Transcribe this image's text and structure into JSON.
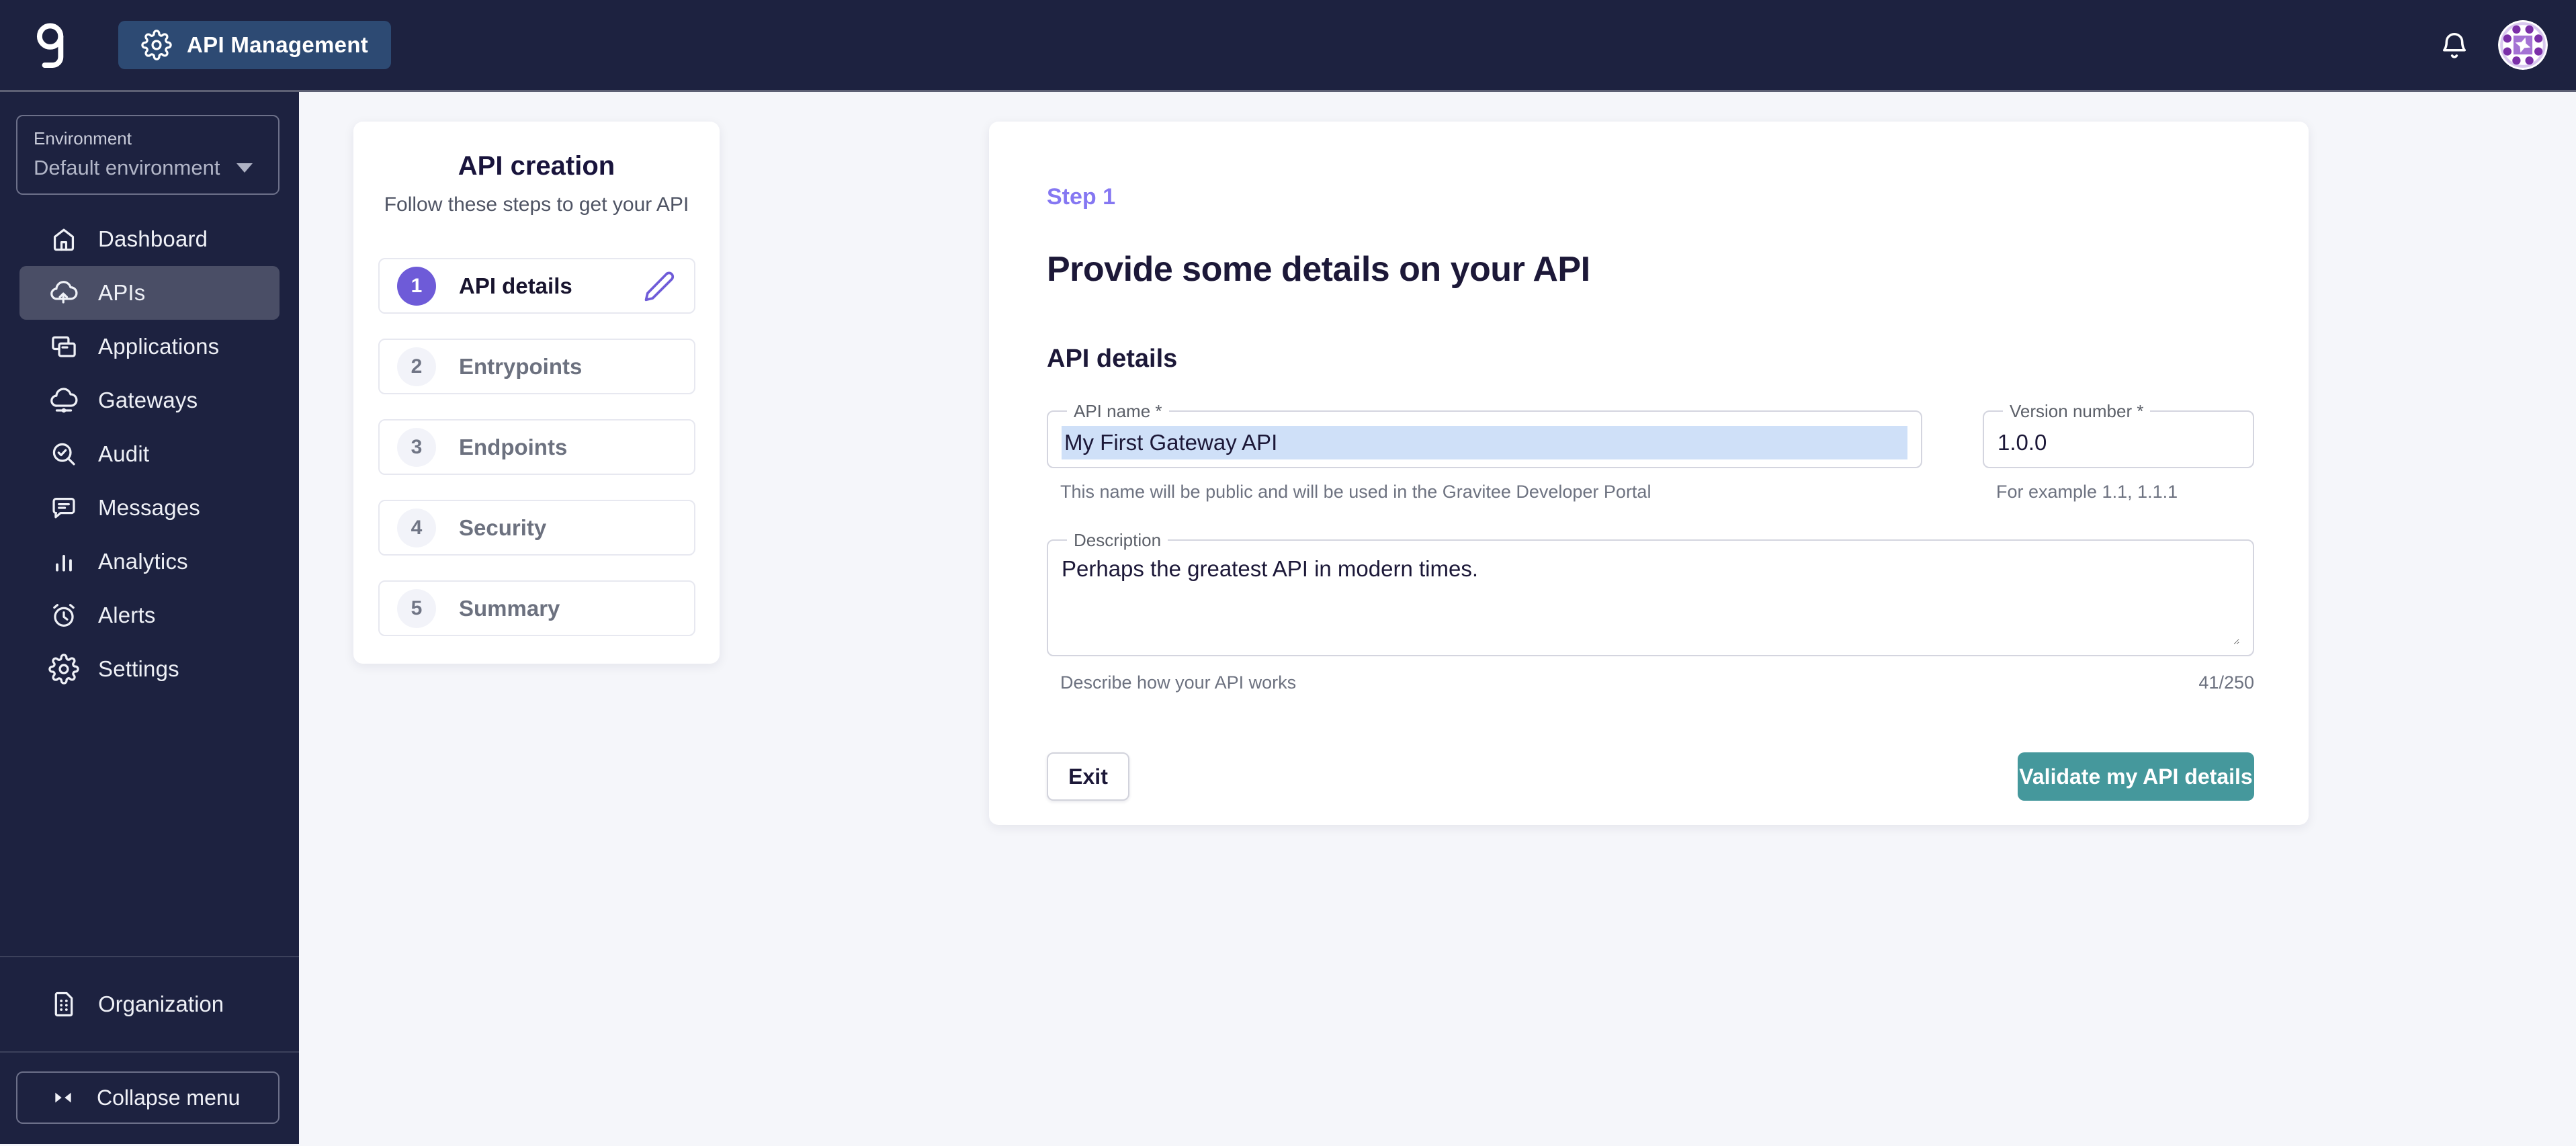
{
  "topbar": {
    "app_label": "API Management"
  },
  "sidebar": {
    "environment": {
      "label": "Environment",
      "value": "Default environment"
    },
    "items": [
      {
        "label": "Dashboard",
        "icon": "home-icon",
        "selected": false
      },
      {
        "label": "APIs",
        "icon": "cloud-upload-icon",
        "selected": true
      },
      {
        "label": "Applications",
        "icon": "applications-icon",
        "selected": false
      },
      {
        "label": "Gateways",
        "icon": "cloud-gateway-icon",
        "selected": false
      },
      {
        "label": "Audit",
        "icon": "magnifier-check-icon",
        "selected": false
      },
      {
        "label": "Messages",
        "icon": "chat-bubble-icon",
        "selected": false
      },
      {
        "label": "Analytics",
        "icon": "bar-chart-icon",
        "selected": false
      },
      {
        "label": "Alerts",
        "icon": "alarm-clock-icon",
        "selected": false
      },
      {
        "label": "Settings",
        "icon": "gear-icon",
        "selected": false
      }
    ],
    "organization_label": "Organization",
    "collapse_label": "Collapse menu"
  },
  "stepper": {
    "title": "API creation",
    "subtitle": "Follow these steps to get your API",
    "steps": [
      {
        "number": "1",
        "label": "API details",
        "active": true
      },
      {
        "number": "2",
        "label": "Entrypoints",
        "active": false
      },
      {
        "number": "3",
        "label": "Endpoints",
        "active": false
      },
      {
        "number": "4",
        "label": "Security",
        "active": false
      },
      {
        "number": "5",
        "label": "Summary",
        "active": false
      }
    ]
  },
  "main": {
    "step_label": "Step 1",
    "title": "Provide some details on your API",
    "section_title": "API details",
    "api_name": {
      "label": "API name *",
      "value": "My First Gateway API",
      "helper": "This name will be public and will be used in the Gravitee Developer Portal"
    },
    "version": {
      "label": "Version number *",
      "value": "1.0.0",
      "helper": "For example 1.1, 1.1.1"
    },
    "description": {
      "label": "Description",
      "value": "Perhaps the greatest API in modern times.",
      "helper": "Describe how your API works",
      "counter": "41/250"
    },
    "exit_label": "Exit",
    "validate_label": "Validate my API details"
  },
  "colors": {
    "topbar_bg": "#1d2240",
    "app_button_bg": "#2d4a73",
    "accent_purple": "#6e5bd8",
    "step_label_purple": "#8577f2",
    "validate_teal": "#45989c",
    "selection_highlight": "#cfe0f8",
    "main_bg": "#f5f6fa"
  }
}
